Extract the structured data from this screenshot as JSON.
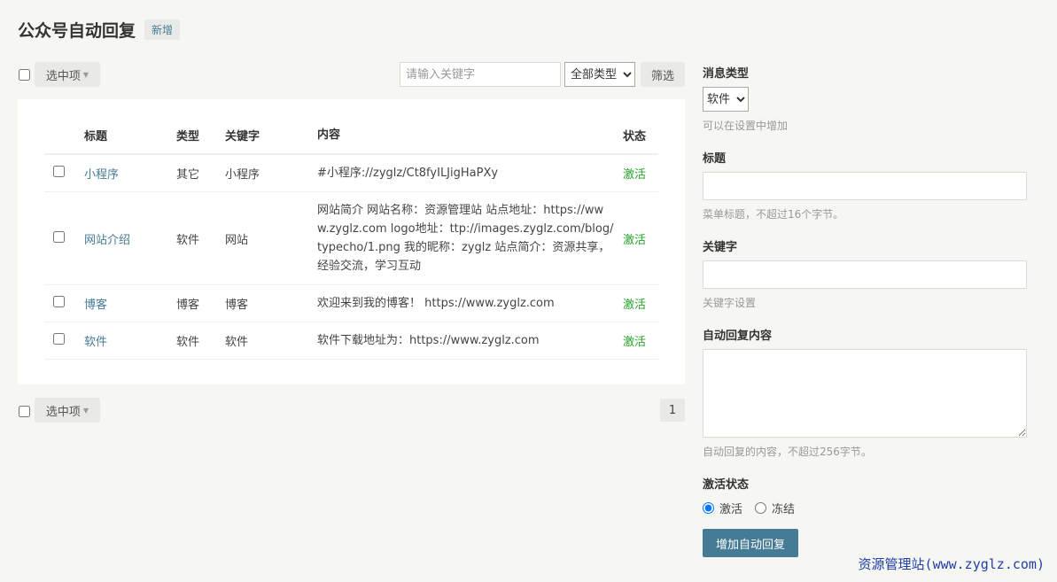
{
  "header": {
    "title": "公众号自动回复",
    "new_label": "新增"
  },
  "toolbar": {
    "select_label": "选中项",
    "search_placeholder": "请输入关键字",
    "type_filter_selected": "全部类型",
    "filter_label": "筛选"
  },
  "table": {
    "headers": {
      "title": "标题",
      "type": "类型",
      "keyword": "关键字",
      "content": "内容",
      "status": "状态"
    },
    "rows": [
      {
        "title": "小程序",
        "type": "其它",
        "keyword": "小程序",
        "content": "#小程序://zyglz/Ct8fyILJigHaPXy",
        "status": "激活"
      },
      {
        "title": "网站介绍",
        "type": "软件",
        "keyword": "网站",
        "content": "网站简介 网站名称：资源管理站 站点地址：https://www.zyglz.com logo地址：ttp://images.zyglz.com/blog/typecho/1.png 我的昵称：zyglz 站点简介：资源共享，经验交流，学习互动",
        "status": "激活"
      },
      {
        "title": "博客",
        "type": "博客",
        "keyword": "博客",
        "content": "欢迎来到我的博客！ https://www.zyglz.com",
        "status": "激活"
      },
      {
        "title": "软件",
        "type": "软件",
        "keyword": "软件",
        "content": "软件下载地址为：https://www.zyglz.com",
        "status": "激活"
      }
    ]
  },
  "pagination": {
    "current_page": "1"
  },
  "form": {
    "msg_type_label": "消息类型",
    "msg_type_selected": "软件",
    "msg_type_hint": "可以在设置中增加",
    "title_label": "标题",
    "title_hint": "菜单标题，不超过16个字节。",
    "keyword_label": "关键字",
    "keyword_hint": "关键字设置",
    "content_label": "自动回复内容",
    "content_hint": "自动回复的内容，不超过256字节。",
    "status_label": "激活状态",
    "status_active": "激活",
    "status_frozen": "冻结",
    "submit_label": "增加自动回复"
  },
  "watermark": "资源管理站(www.zyglz.com)",
  "colors": {
    "accent": "#467b96",
    "active_status": "#26a42a",
    "background": "#f6f6f3"
  }
}
